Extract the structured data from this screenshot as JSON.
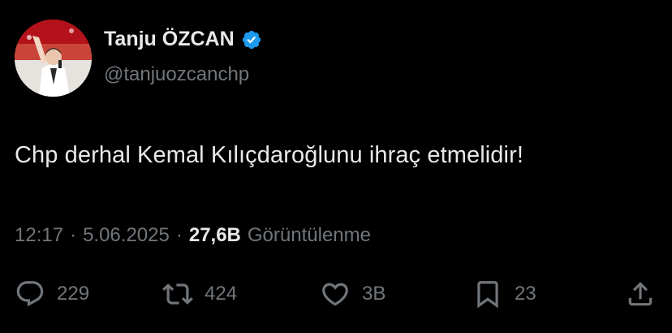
{
  "author": {
    "name": "Tanju ÖZCAN",
    "handle": "@tanjuozcanchp",
    "verified": true,
    "verified_color": "#1d9bf0",
    "avatar_icon": "profile-photo"
  },
  "tweet": {
    "text": "Chp derhal Kemal Kılıçdaroğlunu ihraç etmelidir!"
  },
  "meta": {
    "time": "12:17",
    "separator": "·",
    "date": "5.06.2025",
    "views_count": "27,6B",
    "views_label": "Görüntülenme"
  },
  "actions": {
    "replies": "229",
    "reposts": "424",
    "likes": "3B",
    "bookmarks": "23",
    "share_icon": "share-icon"
  },
  "colors": {
    "background": "#000000",
    "text_primary": "#e7e9ea",
    "text_secondary": "#71767b"
  }
}
